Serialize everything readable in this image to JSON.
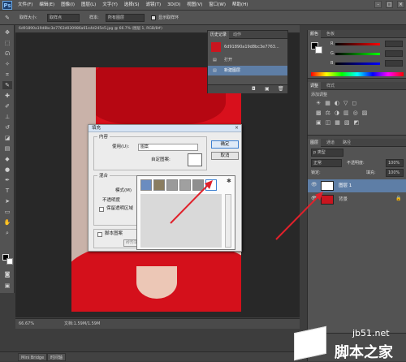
{
  "app": {
    "logo": "Ps"
  },
  "menu": [
    "文件(F)",
    "编辑(E)",
    "图像(I)",
    "图层(L)",
    "文字(Y)",
    "选择(S)",
    "滤镜(T)",
    "3D(D)",
    "视图(V)",
    "窗口(W)",
    "帮助(H)"
  ],
  "window_controls": [
    "-",
    "□",
    "×"
  ],
  "options": {
    "sample_size_label": "取样大小:",
    "sample_size_value": "取样点",
    "sample_label": "样本:",
    "sample_value": "所有图层",
    "ring_label": "显示取样环"
  },
  "doc_tab": "6d91890a19d8bc3e7763d030986a61e4d245e5.jpg @ 66.7% (图层 1, RGB/8#)",
  "status": {
    "zoom": "66.67%",
    "doc": "文档:1.59M/1.59M"
  },
  "bottom_tabs": [
    "Mini Bridge",
    "时间轴"
  ],
  "history_panel": {
    "tabs": [
      "历史记录",
      "动作"
    ],
    "snapshot": "6d91890a19d8bc3e7763...",
    "items": [
      "打开",
      "新建图层"
    ]
  },
  "color_panel": {
    "tabs": [
      "颜色",
      "色板"
    ],
    "sliders": [
      "R",
      "G",
      "B"
    ]
  },
  "adjust_panel": {
    "tabs": [
      "调整",
      "样式"
    ],
    "title": "添加调整"
  },
  "layers_panel": {
    "tabs": [
      "图层",
      "通道",
      "路径"
    ],
    "kind": "p 类型",
    "blend": "正常",
    "opacity_label": "不透明度:",
    "opacity": "100%",
    "lock_label": "锁定:",
    "fill_label": "填充:",
    "fill": "100%",
    "layers": [
      {
        "name": "图层 1",
        "selected": true
      },
      {
        "name": "背景",
        "selected": false
      }
    ]
  },
  "fill_dialog": {
    "title": "填充",
    "content_group": "内容",
    "use_label": "使用(U):",
    "use_value": "图案",
    "custom_pattern_label": "自定图案:",
    "blend_group": "混合",
    "mode_label": "模式(M)",
    "opacity_label": "不透明度",
    "preserve_label": "保留透明区域",
    "script_label": "脚本图案",
    "script_select": "砖形填充",
    "ok": "确定",
    "cancel": "取消"
  },
  "pattern_swatches": 6,
  "watermark": {
    "site": "jb51.net",
    "name": "脚本之家"
  }
}
